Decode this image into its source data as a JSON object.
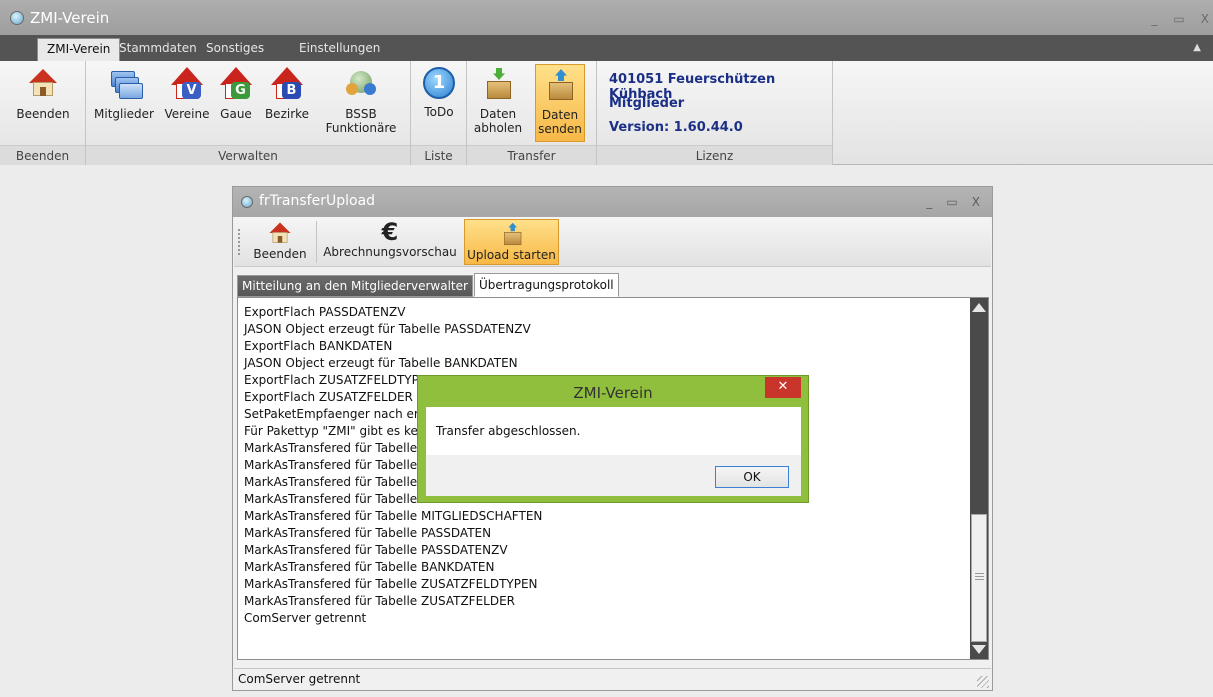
{
  "window": {
    "title": "ZMI-Verein",
    "controls": [
      "_",
      "▭",
      "X"
    ]
  },
  "ribbon_tabs": [
    "ZMI-Verein",
    "Stammdaten",
    "Sonstiges",
    "Einstellungen"
  ],
  "ribbon": {
    "groups": {
      "beenden": "Beenden",
      "verwalten": "Verwalten",
      "liste": "Liste",
      "transfer": "Transfer",
      "lizenz": "Lizenz"
    },
    "buttons": {
      "beenden": "Beenden",
      "mitglieder": "Mitglieder",
      "vereine": "Vereine",
      "gaue": "Gaue",
      "bezirke": "Bezirke",
      "bssb_line1": "BSSB",
      "bssb_line2": "Funktionäre",
      "todo": "ToDo",
      "todo_badge": "1",
      "daten_abholen_1": "Daten",
      "daten_abholen_2": "abholen",
      "daten_senden_1": "Daten",
      "daten_senden_2": "senden"
    },
    "badges": {
      "vereine": "V",
      "gaue": "G",
      "bezirke": "B"
    },
    "license": {
      "club": "401051 Feuerschützen Kühbach",
      "module": "Mitglieder",
      "version": "Version: 1.60.44.0"
    }
  },
  "child_window": {
    "title": "frTransferUpload",
    "controls": [
      "_",
      "▭",
      "X"
    ],
    "toolbar": {
      "beenden": "Beenden",
      "abrechnung": "Abrechnungsvorschau",
      "upload": "Upload starten",
      "euro_icon": "€"
    },
    "tabs": [
      "Mitteilung an den Mitgliederverwalter",
      "Übertragungsprotokoll"
    ],
    "log": [
      "ExportFlach PASSDATENZV",
      "JASON Object erzeugt für Tabelle PASSDATENZV",
      "ExportFlach BANKDATEN",
      "JASON Object erzeugt für Tabelle BANKDATEN",
      "ExportFlach ZUSATZFELDTYPEN",
      "ExportFlach ZUSATZFELDER",
      "SetPaketEmpfaenger nach erfolgreichem Upload",
      "Für Pakettyp \"ZMI\" gibt es keine Empfänger",
      "MarkAsTransfered für Tabelle MITGLIEDER",
      "MarkAsTransfered für Tabelle ADRESSEN",
      "MarkAsTransfered für Tabelle KOMMUNIKATION",
      "MarkAsTransfered für Tabelle FUNKTIONEN",
      "MarkAsTransfered für Tabelle MITGLIEDSCHAFTEN",
      "MarkAsTransfered für Tabelle PASSDATEN",
      "MarkAsTransfered für Tabelle PASSDATENZV",
      "MarkAsTransfered für Tabelle BANKDATEN",
      "MarkAsTransfered für Tabelle ZUSATZFELDTYPEN",
      "MarkAsTransfered für Tabelle ZUSATZFELDER",
      "ComServer getrennt"
    ],
    "status": "ComServer getrennt"
  },
  "dialog": {
    "title": "ZMI-Verein",
    "close": "✕",
    "message": "Transfer abgeschlossen.",
    "ok": "OK"
  },
  "colors": {
    "ribbon_highlight": "#f7b847",
    "license_text": "#1b2f86",
    "dialog_frame": "#8fbf3c",
    "dialog_close": "#c9352a"
  }
}
